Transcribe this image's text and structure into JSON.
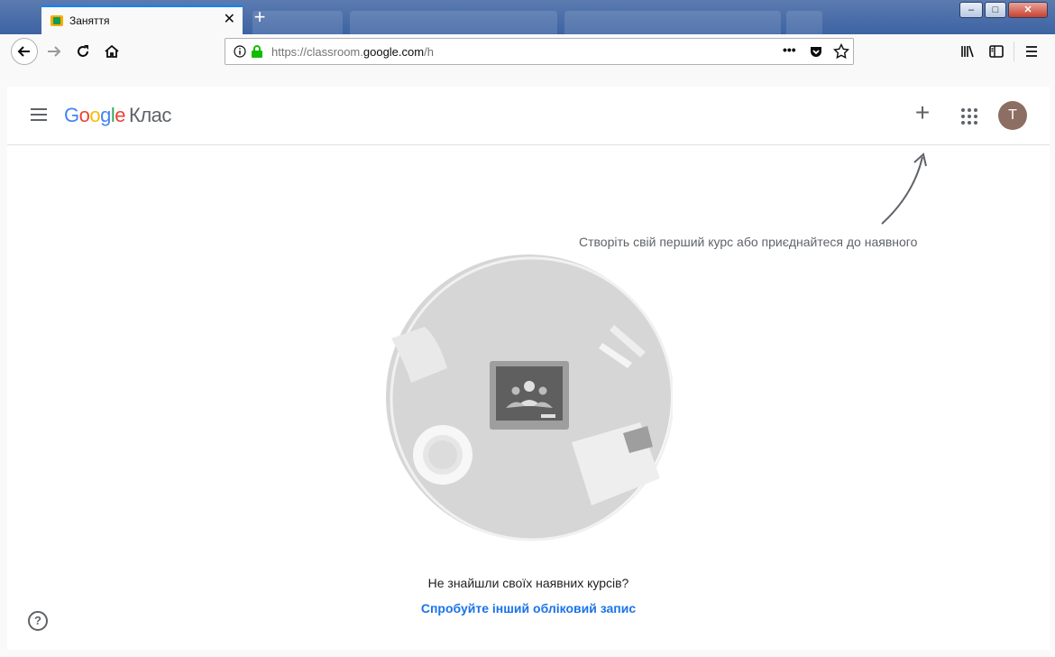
{
  "browser": {
    "tab_title": "Заняття",
    "url_prefix": "https://classroom.",
    "url_domain": "google.com",
    "url_path": "/h",
    "page_actions_label": "•••"
  },
  "app": {
    "logo_google": "Google",
    "logo_product": "Клас",
    "avatar_initial": "T",
    "create_hint": "Створіть свій перший курс або приєднайтеся до наявного",
    "no_courses_question": "Не знайшли своїх наявних курсів?",
    "switch_account_link": "Спробуйте інший обліковий запис"
  },
  "icons": [
    "tab-favicon-icon",
    "close-tab-icon",
    "new-tab-icon",
    "back-icon",
    "forward-icon",
    "reload-icon",
    "home-icon",
    "info-icon",
    "lock-icon",
    "more-icon",
    "pocket-icon",
    "star-icon",
    "library-icon",
    "sidebar-icon",
    "menu-icon",
    "hamburger-icon",
    "plus-icon",
    "apps-icon",
    "help-icon"
  ],
  "colors": {
    "google_blue": "#4285f4",
    "google_red": "#ea4335",
    "google_yellow": "#fbbc05",
    "google_green": "#34a853",
    "link": "#1a73e8",
    "avatar": "#8d6e63"
  }
}
